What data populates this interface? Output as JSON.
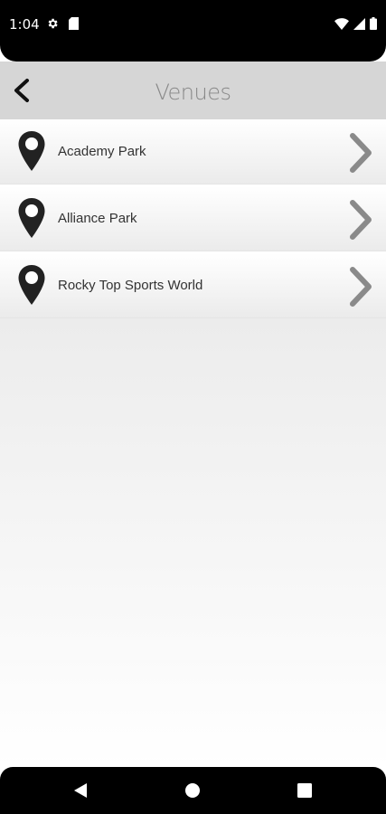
{
  "status_bar": {
    "time": "1:04",
    "left_icons": [
      "gear-icon",
      "sd-card-icon"
    ],
    "right_icons": [
      "wifi-icon",
      "signal-icon",
      "battery-icon"
    ]
  },
  "app_bar": {
    "title": "Venues",
    "back_icon": "chevron-left-icon"
  },
  "venues": [
    {
      "label": "Academy Park",
      "icon": "map-pin-icon"
    },
    {
      "label": "Alliance Park",
      "icon": "map-pin-icon"
    },
    {
      "label": "Rocky Top Sports World",
      "icon": "map-pin-icon"
    }
  ],
  "nav_bar": {
    "buttons": [
      "back-triangle-icon",
      "home-circle-icon",
      "recents-square-icon"
    ]
  },
  "colors": {
    "status_bar": "#000000",
    "app_bar": "#d6d6d6",
    "title": "#888888",
    "chevron": "#8a8a8a",
    "pin": "#222222"
  }
}
